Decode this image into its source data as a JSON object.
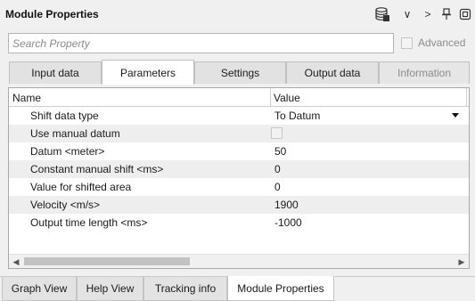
{
  "panel": {
    "title": "Module Properties"
  },
  "toolbar": {
    "icons": [
      "database-icon",
      "chevron-down-icon",
      "chevron-right-icon",
      "pin-icon",
      "restore-icon"
    ],
    "chevron_down": "∨",
    "chevron_right": ">"
  },
  "search": {
    "placeholder": "Search Property",
    "value": ""
  },
  "advanced": {
    "label": "Advanced",
    "checked": false
  },
  "tabs": [
    {
      "label": "Input data",
      "active": false,
      "enabled": true
    },
    {
      "label": "Parameters",
      "active": true,
      "enabled": true
    },
    {
      "label": "Settings",
      "active": false,
      "enabled": true
    },
    {
      "label": "Output data",
      "active": false,
      "enabled": true
    },
    {
      "label": "Information",
      "active": false,
      "enabled": false
    }
  ],
  "grid": {
    "columns": [
      "Name",
      "Value"
    ],
    "rows": [
      {
        "name": "Shift data type",
        "value": "To Datum",
        "kind": "dropdown"
      },
      {
        "name": "Use manual datum",
        "value": "",
        "kind": "checkbox",
        "checked": false
      },
      {
        "name": "Datum <meter>",
        "value": "50",
        "kind": "text"
      },
      {
        "name": "Constant manual shift <ms>",
        "value": "0",
        "kind": "text"
      },
      {
        "name": "Value for shifted area",
        "value": "0",
        "kind": "text"
      },
      {
        "name": "Velocity <m/s>",
        "value": "1900",
        "kind": "text"
      },
      {
        "name": "Output time length <ms>",
        "value": "-1000",
        "kind": "text"
      }
    ]
  },
  "scrollbar": {
    "left_arrow": "◀",
    "right_arrow": "▶"
  },
  "bottom_tabs": [
    {
      "label": "Graph View",
      "active": false
    },
    {
      "label": "Help View",
      "active": false
    },
    {
      "label": "Tracking info",
      "active": false
    },
    {
      "label": "Module Properties",
      "active": true
    }
  ]
}
